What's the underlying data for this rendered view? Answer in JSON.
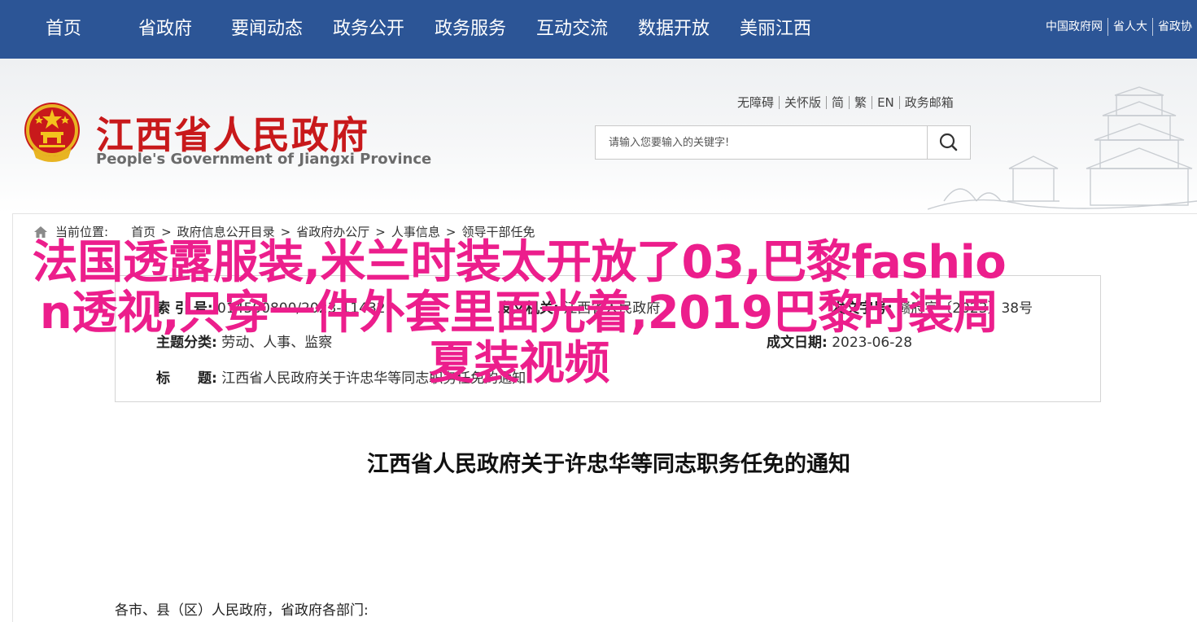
{
  "topnav": {
    "items": [
      "首页",
      "省政府",
      "要闻动态",
      "政务公开",
      "政务服务",
      "互动交流",
      "数据开放",
      "美丽江西"
    ],
    "right_links": [
      "中国政府网",
      "省人大",
      "省政协"
    ]
  },
  "header": {
    "site_title": "江西省人民政府",
    "site_subtitle": "People's Government of Jiangxi Province",
    "util_links": [
      "无障碍",
      "关怀版",
      "简",
      "繁",
      "EN",
      "政务邮箱"
    ],
    "search_placeholder": "请输入您要输入的关键字!"
  },
  "breadcrumb": {
    "label": "当前位置:",
    "items": [
      "首页",
      "政府信息公开目录",
      "省政府办公厅",
      "人事信息",
      "领导干部任免"
    ]
  },
  "meta": {
    "index_label": "索 引 号:",
    "index_value": "014500800/2023-11432",
    "issuer_label": "发文机关:",
    "issuer_value": "江西省人民政府",
    "doc_no_label": "发文字号:",
    "doc_no_value": "赣府字〔2023〕38号",
    "topic_label": "主题分类:",
    "topic_value": "劳动、人事、监察",
    "date_label": "成文日期:",
    "date_value": "2023-06-28",
    "subject_label": "标　　题:",
    "subject_value": "江西省人民政府关于许忠华等同志职务任免的通知"
  },
  "overlay_title": "法国透露服装,米兰时装太开放了03,巴黎fashion透视,只穿一件外套里面光着,2019巴黎时装周夏装视频",
  "article": {
    "title": "江西省人民政府关于许忠华等同志职务任免的通知",
    "greeting": "各市、县（区）人民政府，省政府各部门:"
  },
  "colors": {
    "nav_bg": "#2c5596",
    "brand_red": "#c8191b",
    "overlay_pink": "#ec1e8c"
  }
}
